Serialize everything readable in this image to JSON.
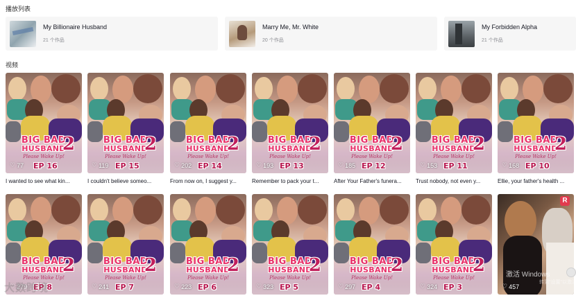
{
  "sections": {
    "playlists_title": "播放列表",
    "videos_title": "视频"
  },
  "playlists": [
    {
      "title": "My Billionaire Husband",
      "count": "21 个作品",
      "thumb_icon": "document-thumbnail"
    },
    {
      "title": "Marry Me, Mr. White",
      "count": "20 个作品",
      "thumb_icon": "portrait-thumbnail"
    },
    {
      "title": "My Forbidden Alpha",
      "count": "21 个作品",
      "thumb_icon": "building-thumbnail"
    }
  ],
  "poster": {
    "line1": "BIG BAD",
    "line2": "HUSBAND",
    "number": "2",
    "tagline": "Please Wake Up!"
  },
  "videos": [
    {
      "likes": "77",
      "ep": "EP 16",
      "caption": "I wanted to see what kin..."
    },
    {
      "likes": "119",
      "ep": "EP 15",
      "caption": "I couldn't believe someo..."
    },
    {
      "likes": "202",
      "ep": "EP 14",
      "caption": "From now on, I suggest y..."
    },
    {
      "likes": "193",
      "ep": "EP 13",
      "caption": "Remember to pack your t..."
    },
    {
      "likes": "185",
      "ep": "EP 12",
      "caption": "After Your Father's funera..."
    },
    {
      "likes": "153",
      "ep": "EP 11",
      "caption": "Trust nobody, not even y..."
    },
    {
      "likes": "168",
      "ep": "EP 10",
      "caption": "Ellie, your father's health ..."
    },
    {
      "likes": "279",
      "ep": "EP 8",
      "caption": ""
    },
    {
      "likes": "241",
      "ep": "EP 7",
      "caption": ""
    },
    {
      "likes": "223",
      "ep": "EP 6",
      "caption": ""
    },
    {
      "likes": "323",
      "ep": "EP 5",
      "caption": ""
    },
    {
      "likes": "297",
      "ep": "EP 4",
      "caption": ""
    },
    {
      "likes": "324",
      "ep": "EP 3",
      "caption": ""
    },
    {
      "likes": "457",
      "ep": "",
      "caption": "",
      "alt": true,
      "badge": "R"
    }
  ],
  "overlays": {
    "windows_activate": "激活 Windows",
    "windows_activate_sub": "转到\"设置\"以激活 Windows。",
    "corner_logo": "大数跨境"
  },
  "colors": {
    "accent": "#e8326a",
    "ep_text": "#b8174f",
    "card_bg": "#f6f6f6",
    "badge": "#e23a4e"
  }
}
